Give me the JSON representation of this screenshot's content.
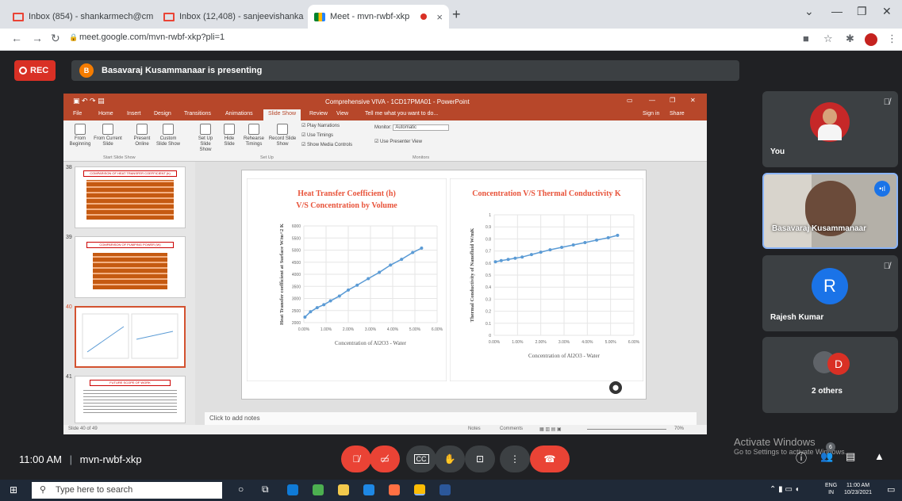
{
  "browser": {
    "tabs": [
      {
        "title": "Inbox (854) - shankarmech@cm",
        "active": false
      },
      {
        "title": "Inbox (12,408) - sanjeevishanka",
        "active": false
      },
      {
        "title": "Meet - mvn-rwbf-xkp",
        "active": true
      }
    ],
    "tab_close": "×",
    "new_tab": "+",
    "url": "meet.google.com/mvn-rwbf-xkp?pli=1"
  },
  "meet": {
    "rec_label": "REC",
    "presenter_initial": "B",
    "presenting_text": "Basavaraj Kusammanaar is presenting",
    "meeting_time": "11:00 AM",
    "meeting_code": "mvn-rwbf-xkp",
    "tiles": [
      {
        "name": "You"
      },
      {
        "name": "Basavaraj Kusammanaar"
      },
      {
        "name": "Rajesh Kumar",
        "initial": "R"
      },
      {
        "name": "2 others",
        "initial": "D"
      }
    ],
    "activate_title": "Activate Windows",
    "activate_sub": "Go to Settings to activate Windows.",
    "people_count": "6"
  },
  "ppt": {
    "window_title": "Comprehensive VIVA - 1CD17PMA01 - PowerPoint",
    "sign_in": "Sign in",
    "share": "Share",
    "ribbon_tabs": [
      "File",
      "Home",
      "Insert",
      "Design",
      "Transitions",
      "Animations",
      "Slide Show",
      "Review",
      "View"
    ],
    "tell_me": "Tell me what you want to do...",
    "ribbon_buttons": [
      {
        "label": "From Beginning"
      },
      {
        "label": "From Current Slide"
      },
      {
        "label": "Present Online"
      },
      {
        "label": "Custom Slide Show"
      },
      {
        "label": "Set Up Slide Show"
      },
      {
        "label": "Hide Slide"
      },
      {
        "label": "Rehearse Timings"
      },
      {
        "label": "Record Slide Show"
      }
    ],
    "checks": [
      "Play Narrations",
      "Use Timings",
      "Show Media Controls"
    ],
    "monitor_label": "Monitor:",
    "monitor_value": "Automatic",
    "presenter_view": "Use Presenter View",
    "groups": [
      "Start Slide Show",
      "Set Up",
      "Monitors"
    ],
    "thumb_numbers": [
      "38",
      "39",
      "40",
      "41"
    ],
    "thumb_titles": [
      "COMPARISON OF HEAT TRANSFER COEFFICIENT (h)",
      "COMPARISON OF PUMPING POWER (W)",
      "",
      "FUTURE SCOPE OF WORK"
    ],
    "notes_placeholder": "Click to add notes",
    "status_left": "Slide 40 of 49",
    "status_notes": "Notes",
    "status_comments": "Comments",
    "zoom": "70%"
  },
  "chart_data": [
    {
      "type": "line",
      "title": "Heat Transfer Coefficient (h) V/S Concentration by Volume",
      "xlabel": "Concentration of Al2O3 - Water",
      "ylabel": "Heat Transfer coefficient at Surface W/m^2 K",
      "x_ticks": [
        "0.00%",
        "1.00%",
        "2.00%",
        "3.00%",
        "4.00%",
        "5.00%",
        "6.00%"
      ],
      "y_ticks": [
        "2000",
        "2500",
        "3000",
        "3500",
        "4000",
        "4500",
        "5000",
        "5500",
        "6000"
      ],
      "xlim": [
        0,
        6
      ],
      "ylim": [
        2000,
        6000
      ],
      "x": [
        0.05,
        0.3,
        0.6,
        0.9,
        1.2,
        1.6,
        2.0,
        2.4,
        2.9,
        3.4,
        3.9,
        4.4,
        4.9,
        5.3
      ],
      "values": [
        2230,
        2450,
        2620,
        2740,
        2900,
        3100,
        3350,
        3550,
        3820,
        4080,
        4380,
        4620,
        4900,
        5080
      ],
      "color": "#5b9bd5"
    },
    {
      "type": "line",
      "title": "Concentration V/S Thermal Conductivity K",
      "xlabel": "Concentration of Al2O3 - Water",
      "ylabel": "Thermal Conductivity of Nanofluid W/mK",
      "x_ticks": [
        "0.00%",
        "1.00%",
        "2.00%",
        "3.00%",
        "4.00%",
        "5.00%",
        "6.00%"
      ],
      "y_ticks": [
        "0",
        "0.1",
        "0.2",
        "0.3",
        "0.4",
        "0.5",
        "0.6",
        "0.7",
        "0.8",
        "0.9",
        "1"
      ],
      "xlim": [
        0,
        6
      ],
      "ylim": [
        0,
        1
      ],
      "x": [
        0.05,
        0.3,
        0.6,
        0.9,
        1.2,
        1.6,
        2.0,
        2.4,
        2.9,
        3.4,
        3.9,
        4.4,
        4.9,
        5.3
      ],
      "values": [
        0.61,
        0.62,
        0.63,
        0.64,
        0.65,
        0.67,
        0.69,
        0.71,
        0.73,
        0.75,
        0.77,
        0.79,
        0.81,
        0.83
      ],
      "color": "#5b9bd5"
    }
  ],
  "taskbar": {
    "search_placeholder": "Type here to search",
    "lang1": "ENG",
    "lang2": "IN",
    "clock_time": "11:00 AM",
    "clock_date": "10/23/2021"
  },
  "colors": {
    "rec": "#d93025",
    "end_call": "#ea4335",
    "ppt": "#b7472a",
    "tile_bg": "#3c4043"
  }
}
